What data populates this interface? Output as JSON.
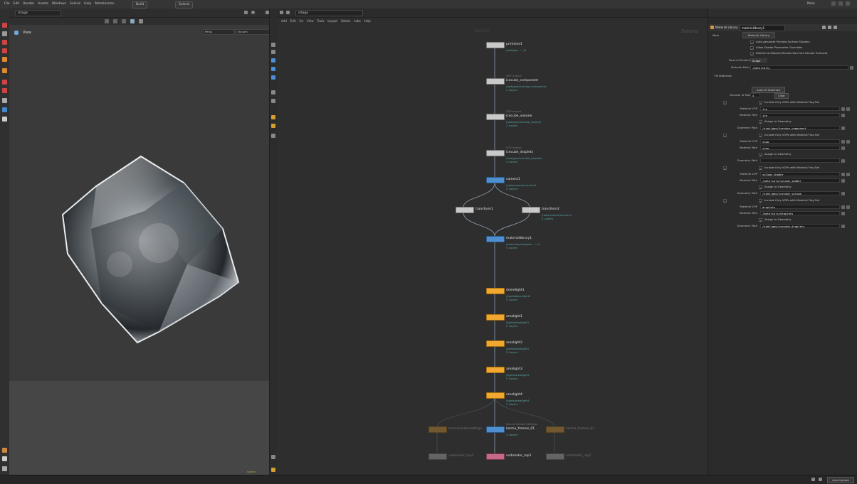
{
  "menu": [
    "File",
    "Edit",
    "Render",
    "Assets",
    "Windows",
    "Solaris",
    "Help",
    "MetaHuman"
  ],
  "tabs": [
    "Build",
    "Solaris"
  ],
  "right_title": "Main",
  "left_pane": {
    "path": "/stage",
    "view_label": "View",
    "persp": "Persp",
    "camera": "No cam",
    "status": "Solaris"
  },
  "network": {
    "path": "/stage",
    "menu": [
      "Add",
      "Edit",
      "Go",
      "View",
      "Tools",
      "Layout",
      "Solaris",
      "Labs",
      "Help"
    ],
    "title": "Solaris",
    "subtitle": "Solaris",
    "nodes": [
      {
        "name": "primitive1",
        "sub": "/root/geo ...: /0"
      },
      {
        "name": "icecube_component",
        "type": "SOP Import",
        "sub": "/root/geo/icecube_component\n2 Layers"
      },
      {
        "name": "icecube_volume",
        "type": "SOP Import",
        "sub": "/root/geo/icecube_volume\n3 Layers"
      },
      {
        "name": "icecube_droplets",
        "type": "SOP Import",
        "sub": "/root/geo/icecube_droplets\n4 Layers"
      },
      {
        "name": "camera1",
        "sub": "/root/camera/camera1\n5 Layers"
      },
      {
        "name": "transform1",
        "sub": ""
      },
      {
        "name": "transform2",
        "sub": "/root/camera/camera1\n5 Layers"
      },
      {
        "name": "materiallibrary1",
        "sub": "/materials/droplets ...: /4\n5 Layers"
      },
      {
        "name": "domelight1",
        "sub": "/lights/domelight1\n5 Layers"
      },
      {
        "name": "arealight1",
        "sub": "/lights/arealight1\n5 Layers"
      },
      {
        "name": "arealight2",
        "sub": "/lights/arealight2\n5 Layers"
      },
      {
        "name": "arealight3",
        "sub": "/lights/arealight3\n5 Layers"
      },
      {
        "name": "arealight4",
        "sub": "/lights/arealight4\n5 Layers"
      },
      {
        "name": "karma_frames_01",
        "type": "Karma Render Settings",
        "sub": "5 Layers"
      },
      {
        "name": "usdrender_rop3",
        "sub": ""
      }
    ],
    "faded_nodes": [
      {
        "name": "karmarendersettings",
        "sub": ""
      },
      {
        "name": "karma_frames_02",
        "sub": ""
      },
      {
        "name": "usdrender_rop1",
        "sub": ""
      },
      {
        "name": "usdrender_rop2",
        "sub": ""
      }
    ]
  },
  "params": {
    "node_type": "Material Library",
    "node_name": "materiallibrary1",
    "tabs": [
      "Main",
      "Material Library"
    ],
    "options": [
      "Auto-generate Preview Surface Shaders",
      "Allow Shader Parameter Overrides",
      "Reference Material Render-Vars Into Render Products"
    ],
    "parent_primitive_type_label": "Parent Primitive Type",
    "parent_primitive_type": "Scope",
    "material_path_prefix_label": "Material Path Prefix",
    "material_path_prefix": "/materials/",
    "section_label": "Fill Materials",
    "fill_button": "Auto-fill Materials",
    "num_materials_label": "Number of Materials",
    "num_materials": "4",
    "clear_label": "Clear",
    "only_vops_label": "Include Only VOPs with Material Flag Set",
    "assign_label": "Assign to Geometry",
    "material_vop_label": "Material VOP",
    "material_path_label": "Material Path",
    "geometry_path_label": "Geometry Path",
    "materials": [
      {
        "vop": "ice",
        "path": "ice",
        "geo": "/shot/geo/icecube_component"
      },
      {
        "vop": "snow",
        "path": "snow",
        "geo": ""
      },
      {
        "vop": "volume_shader",
        "path": "/materials/volume_shader",
        "geo": "/shot/geo/icecube_volume"
      },
      {
        "vop": "droplets",
        "path": "/materials/droplets",
        "geo": "/shot/geo/icecube_droplets"
      }
    ]
  },
  "statusbar": {
    "right": "Auto Update"
  },
  "colors": {
    "node_orange": "#f0a830",
    "node_blue": "#4f8fd0",
    "node_pink": "#c56a86",
    "node_gray": "#c9c9c9",
    "wire": "#8f9fb0",
    "param_bg": "#2b2b2b"
  }
}
